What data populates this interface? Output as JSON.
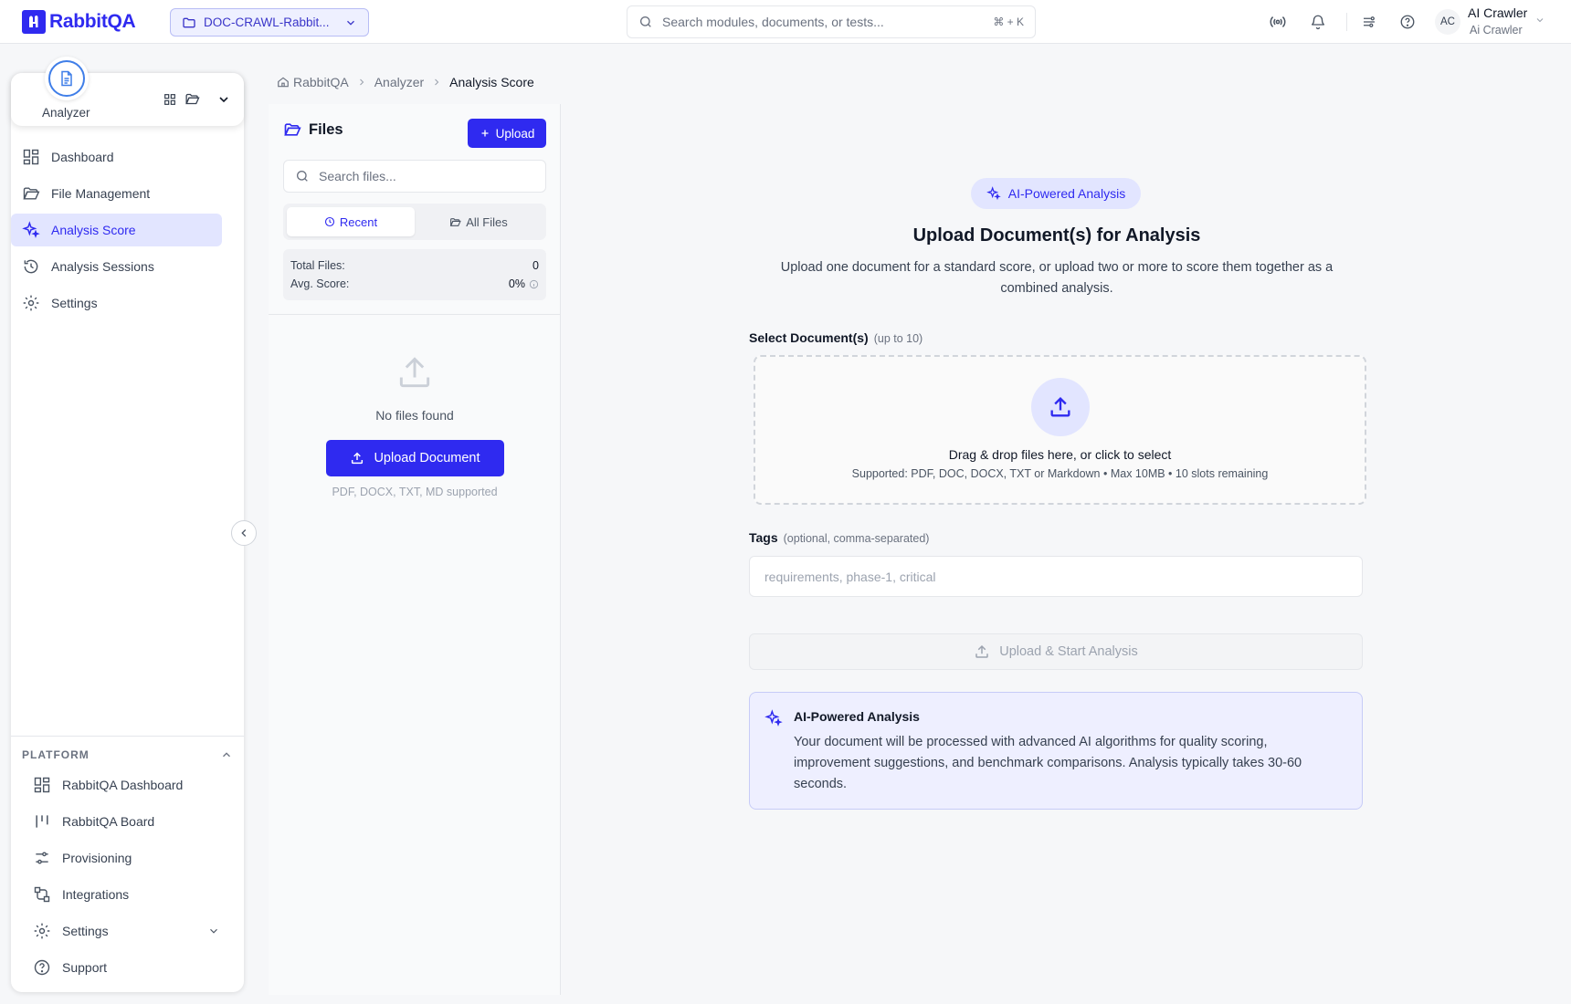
{
  "brand": {
    "logo_text": "RabbitQA",
    "accent": "#2f2af0"
  },
  "header": {
    "project": "DOC-CRAWL-Rabbit...",
    "search_placeholder": "Search modules, documents, or tests...",
    "search_shortcut": "⌘ + K",
    "user": {
      "initials": "AC",
      "name": "AI Crawler",
      "subtitle": "Ai Crawler"
    }
  },
  "sidebar": {
    "module": "Analyzer",
    "items": [
      {
        "label": "Dashboard",
        "icon": "dashboard-icon"
      },
      {
        "label": "File Management",
        "icon": "folder-icon"
      },
      {
        "label": "Analysis Score",
        "icon": "sparkles-icon",
        "active": true
      },
      {
        "label": "Analysis Sessions",
        "icon": "history-icon"
      },
      {
        "label": "Settings",
        "icon": "gear-icon"
      }
    ],
    "platform_title": "PLATFORM",
    "platform_items": [
      {
        "label": "RabbitQA Dashboard",
        "icon": "dashboard-icon"
      },
      {
        "label": "RabbitQA Board",
        "icon": "board-icon"
      },
      {
        "label": "Provisioning",
        "icon": "sliders-icon"
      },
      {
        "label": "Integrations",
        "icon": "integrations-icon"
      },
      {
        "label": "Settings",
        "icon": "gear-icon"
      },
      {
        "label": "Support",
        "icon": "help-icon"
      }
    ]
  },
  "breadcrumb": {
    "home": "RabbitQA",
    "section": "Analyzer",
    "current": "Analysis Score"
  },
  "files": {
    "title": "Files",
    "upload_label": "Upload",
    "search_placeholder": "Search files...",
    "tabs": {
      "recent": "Recent",
      "all": "All Files"
    },
    "stats": {
      "total_label": "Total Files:",
      "total_value": "0",
      "avg_label": "Avg. Score:",
      "avg_value": "0%"
    },
    "empty_text": "No files found",
    "upload_document_label": "Upload Document",
    "supported_text": "PDF, DOCX, TXT, MD supported"
  },
  "main": {
    "badge": "AI-Powered Analysis",
    "title": "Upload Document(s) for Analysis",
    "subtitle": "Upload one document for a standard score, or upload two or more to score them together as a combined analysis.",
    "select_label": "Select Document(s)",
    "select_hint": "(up to 10)",
    "dropzone_title": "Drag & drop files here, or click to select",
    "dropzone_sub": "Supported: PDF, DOC, DOCX, TXT or Markdown • Max 10MB • 10 slots remaining",
    "tags_label": "Tags",
    "tags_hint": "(optional, comma-separated)",
    "tags_placeholder": "requirements, phase-1, critical",
    "start_label": "Upload & Start Analysis",
    "info_title": "AI-Powered Analysis",
    "info_text": "Your document will be processed with advanced AI algorithms for quality scoring, improvement suggestions, and benchmark comparisons. Analysis typically takes 30-60 seconds."
  }
}
